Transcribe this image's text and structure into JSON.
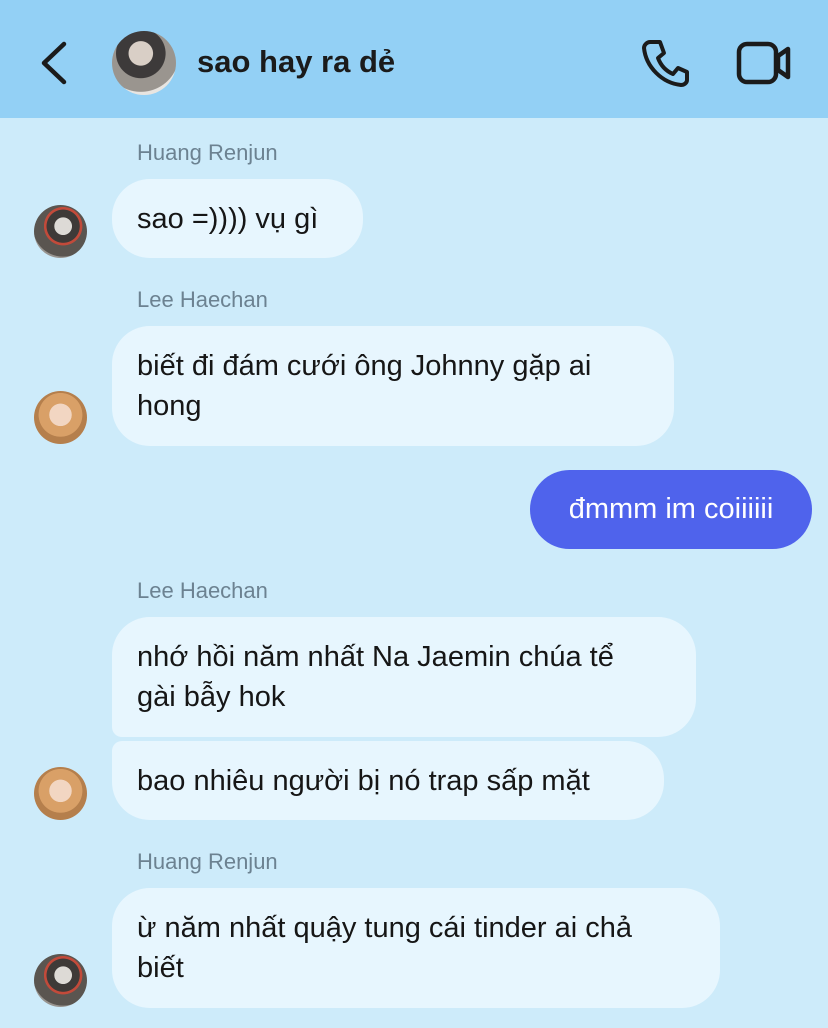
{
  "header": {
    "title": "sao hay ra dẻ",
    "back_icon": "chevron-left-icon",
    "call_icon": "phone-icon",
    "video_icon": "video-camera-icon"
  },
  "messages": [
    {
      "sender": "Huang Renjun",
      "lines": [
        "sao =)))) vụ gì"
      ]
    },
    {
      "sender": "Lee Haechan",
      "lines": [
        "biết đi đám cưới ông Johnny gặp ai",
        "hong"
      ]
    },
    {
      "outgoing": "đmmm im coiiiiii"
    },
    {
      "sender": "Lee Haechan",
      "lines": [
        "nhớ hồi năm nhất Na Jaemin chúa tể",
        "gài bẫy hok"
      ]
    },
    {
      "lines": [
        "bao nhiêu người bị nó trap sấp mặt"
      ]
    },
    {
      "sender": "Huang Renjun",
      "lines": [
        "ừ năm nhất quậy tung cái tinder ai chả",
        "biết"
      ]
    }
  ],
  "colors": {
    "background": "#cdebfa",
    "header": "#93d0f5",
    "incoming_bubble": "#e7f6fe",
    "outgoing_bubble": "#4f63ec"
  }
}
